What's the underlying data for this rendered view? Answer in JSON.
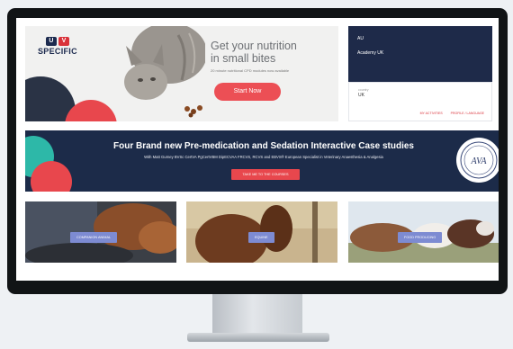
{
  "brand": {
    "mark_letters": [
      "U",
      "V"
    ],
    "name": "SPECIFIC"
  },
  "hero": {
    "title_line1": "Get your nutrition",
    "title_line2": "in small bites",
    "subtitle": "20 minute nutritional CPD modules now available",
    "cta_label": "Start Now"
  },
  "account": {
    "region_code": "AU",
    "organization": "Academy UK",
    "field_label": "country",
    "field_value": "UK",
    "link_activities": "MY ACTIVITIES",
    "link_language": "PROFILE / LANGUAGE"
  },
  "promo": {
    "title": "Four Brand new Pre-medication and Sedation Interactive Case studies",
    "subtitle": "With Matt Gurney BVSc CertVA PgCertVBM DipECVAA FRCVS, RCVS and EBVS® European Specialist in Veterinary Anaesthesia & Analgesia",
    "cta_label": "TAKE ME TO THE COURSES",
    "seal_text": "AVA"
  },
  "categories": [
    {
      "label": "COMPANION ANIMAL"
    },
    {
      "label": "EQUINE"
    },
    {
      "label": "FOOD PRODUCING"
    }
  ],
  "colors": {
    "navy": "#1c2b49",
    "coral": "#e8474d",
    "teal": "#2db8a8",
    "tile_button": "#7d8bd2"
  }
}
